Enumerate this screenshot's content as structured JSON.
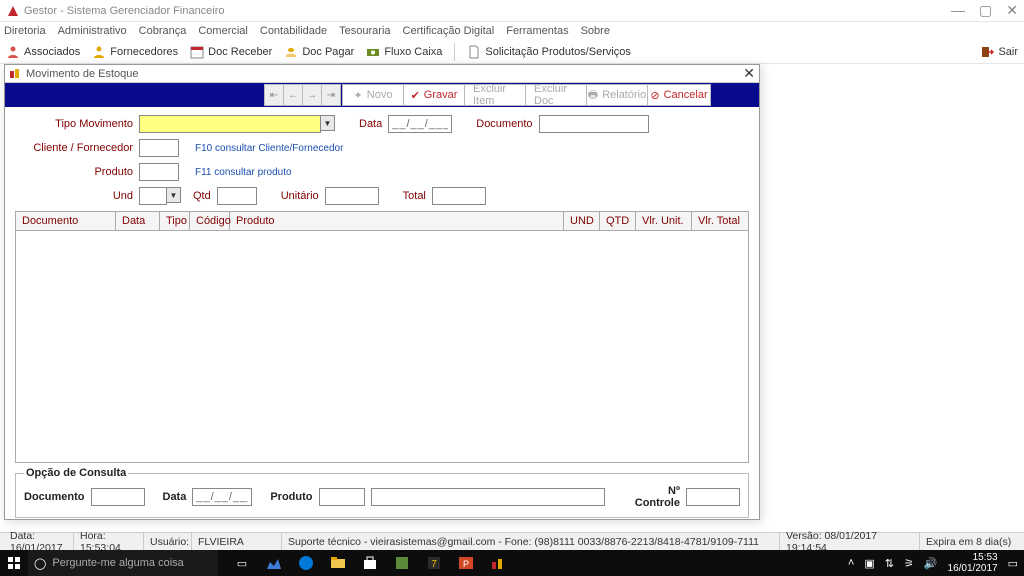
{
  "window": {
    "title": "Gestor - Sistema Gerenciador Financeiro"
  },
  "menubar": [
    "Diretoria",
    "Administrativo",
    "Cobrança",
    "Comercial",
    "Contabilidade",
    "Tesouraria",
    "Certificação Digital",
    "Ferramentas",
    "Sobre"
  ],
  "toolbar": {
    "associados": "Associados",
    "fornecedores": "Fornecedores",
    "doc_receber": "Doc Receber",
    "doc_pagar": "Doc Pagar",
    "fluxo_caixa": "Fluxo Caixa",
    "solicitacao": "Solicitação Produtos/Serviços",
    "sair": "Sair"
  },
  "modal": {
    "title": "Movimento de Estoque",
    "buttons": {
      "novo": "Novo",
      "gravar": "Gravar",
      "excluir_item": "Excluir Item",
      "excluir_doc": "Excluir Doc",
      "relatorio": "Relatório",
      "cancelar": "Cancelar"
    },
    "labels": {
      "tipo_movimento": "Tipo Movimento",
      "data": "Data",
      "documento": "Documento",
      "cliente_fornecedor": "Cliente / Fornecedor",
      "produto": "Produto",
      "und": "Und",
      "qtd": "Qtd",
      "unitario": "Unitário",
      "total": "Total",
      "hint_cliente": "F10 consultar Cliente/Fornecedor",
      "hint_produto": "F11 consultar produto",
      "date_mask": "__/__/____"
    },
    "columns": [
      "Documento",
      "Data",
      "Tipo",
      "Código",
      "Produto",
      "UND",
      "QTD",
      "Vlr. Unit.",
      "Vlr. Total"
    ],
    "consulta": {
      "legend": "Opção de Consulta",
      "documento": "Documento",
      "data": "Data",
      "produto": "Produto",
      "n_controle": "Nº Controle",
      "date_mask": "__/__/____"
    }
  },
  "statusbar": {
    "data": "Data: 16/01/2017",
    "hora": "Hora: 15:53:04",
    "usuario_label": "Usuário:",
    "usuario": "FLVIEIRA",
    "suporte": "Suporte técnico - vieirasistemas@gmail.com - Fone: (98)8111 0033/8876-2213/8418-4781/9109-7111",
    "versao": "Versão: 08/01/2017 19:14:54",
    "expira": "Expira em 8 dia(s)"
  },
  "taskbar": {
    "search_placeholder": "Pergunte-me alguma coisa",
    "time": "15:53",
    "date": "16/01/2017"
  }
}
